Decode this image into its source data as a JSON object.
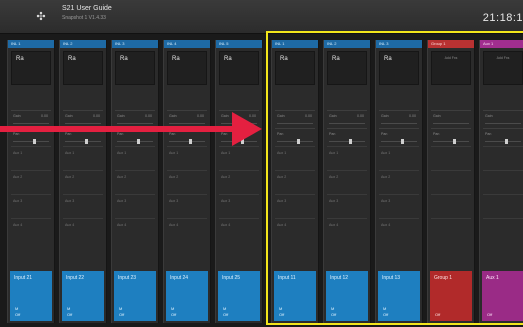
{
  "header": {
    "title": "S21 User Guide",
    "subtitle": "Snapshot 1 V1.4.33",
    "subtitle2": "",
    "clock": "21:18:1"
  },
  "channels": [
    {
      "id": "ch1",
      "head": "INL 1",
      "name": "Ra",
      "gain": "Gain",
      "gainVal": "0.00",
      "pan": "Pan",
      "aux": [
        "Aux 1",
        "Aux 2",
        "Aux 3",
        "Aux 4"
      ],
      "btn": "Input 21",
      "btnSub1": "M",
      "btnSub2": "Off",
      "type": "input"
    },
    {
      "id": "ch2",
      "head": "INL 2",
      "name": "Ra",
      "gain": "Gain",
      "gainVal": "0.00",
      "pan": "Pan",
      "aux": [
        "Aux 1",
        "Aux 2",
        "Aux 3",
        "Aux 4"
      ],
      "btn": "Input 22",
      "btnSub1": "M",
      "btnSub2": "Off",
      "type": "input"
    },
    {
      "id": "ch3",
      "head": "INL 3",
      "name": "Ra",
      "gain": "Gain",
      "gainVal": "0.00",
      "pan": "Pan",
      "aux": [
        "Aux 1",
        "Aux 2",
        "Aux 3",
        "Aux 4"
      ],
      "btn": "Input 23",
      "btnSub1": "M",
      "btnSub2": "Off",
      "type": "input"
    },
    {
      "id": "ch4",
      "head": "INL 4",
      "name": "Ra",
      "gain": "Gain",
      "gainVal": "0.00",
      "pan": "Pan",
      "aux": [
        "Aux 1",
        "Aux 2",
        "Aux 3",
        "Aux 4"
      ],
      "btn": "Input 24",
      "btnSub1": "M",
      "btnSub2": "Off",
      "type": "input"
    },
    {
      "id": "ch5",
      "head": "INL 5",
      "name": "Ra",
      "gain": "Gain",
      "gainVal": "0.00",
      "pan": "Pan",
      "aux": [
        "Aux 1",
        "Aux 2",
        "Aux 3",
        "Aux 4"
      ],
      "btn": "Input 25",
      "btnSub1": "M",
      "btnSub2": "Off",
      "type": "input"
    },
    {
      "id": "ch6",
      "head": "INL 1",
      "name": "Ra",
      "gain": "Gain",
      "gainVal": "0.00",
      "pan": "Pan",
      "aux": [
        "Aux 1",
        "Aux 2",
        "Aux 3",
        "Aux 4"
      ],
      "btn": "Input 11",
      "btnSub1": "M",
      "btnSub2": "Off",
      "type": "input"
    },
    {
      "id": "ch7",
      "head": "INL 2",
      "name": "Ra",
      "gain": "Gain",
      "gainVal": "0.00",
      "pan": "Pan",
      "aux": [
        "Aux 1",
        "Aux 2",
        "Aux 3",
        "Aux 4"
      ],
      "btn": "Input 12",
      "btnSub1": "M",
      "btnSub2": "Off",
      "type": "input"
    },
    {
      "id": "ch8",
      "head": "INL 3",
      "name": "Ra",
      "gain": "Gain",
      "gainVal": "0.00",
      "pan": "Pan",
      "aux": [
        "Aux 1",
        "Aux 2",
        "Aux 3",
        "Aux 4"
      ],
      "btn": "Input 13",
      "btnSub1": "M",
      "btnSub2": "Off",
      "type": "input"
    },
    {
      "id": "grp1",
      "head": "Group 1",
      "name": "Add Fxs",
      "gain": "Gain",
      "gainVal": "",
      "pan": "Pan",
      "aux": [
        "",
        "",
        "",
        ""
      ],
      "btn": "Group 1",
      "btnSub1": "",
      "btnSub2": "Off",
      "type": "group"
    },
    {
      "id": "aux1",
      "head": "Aux 1",
      "name": "Add Fxs",
      "gain": "Gain",
      "gainVal": "",
      "pan": "Pan",
      "aux": [
        "",
        "",
        "",
        ""
      ],
      "btn": "Aux 1",
      "btnSub1": "",
      "btnSub2": "Off",
      "type": "aux"
    }
  ],
  "colors": {
    "input": "#1e7fc0",
    "group": "#b12a2a",
    "aux": "#9a2b86",
    "highlight": "#f2e51b",
    "arrow": "#e42040"
  },
  "icons": {
    "logo": "dots-logo-icon"
  }
}
